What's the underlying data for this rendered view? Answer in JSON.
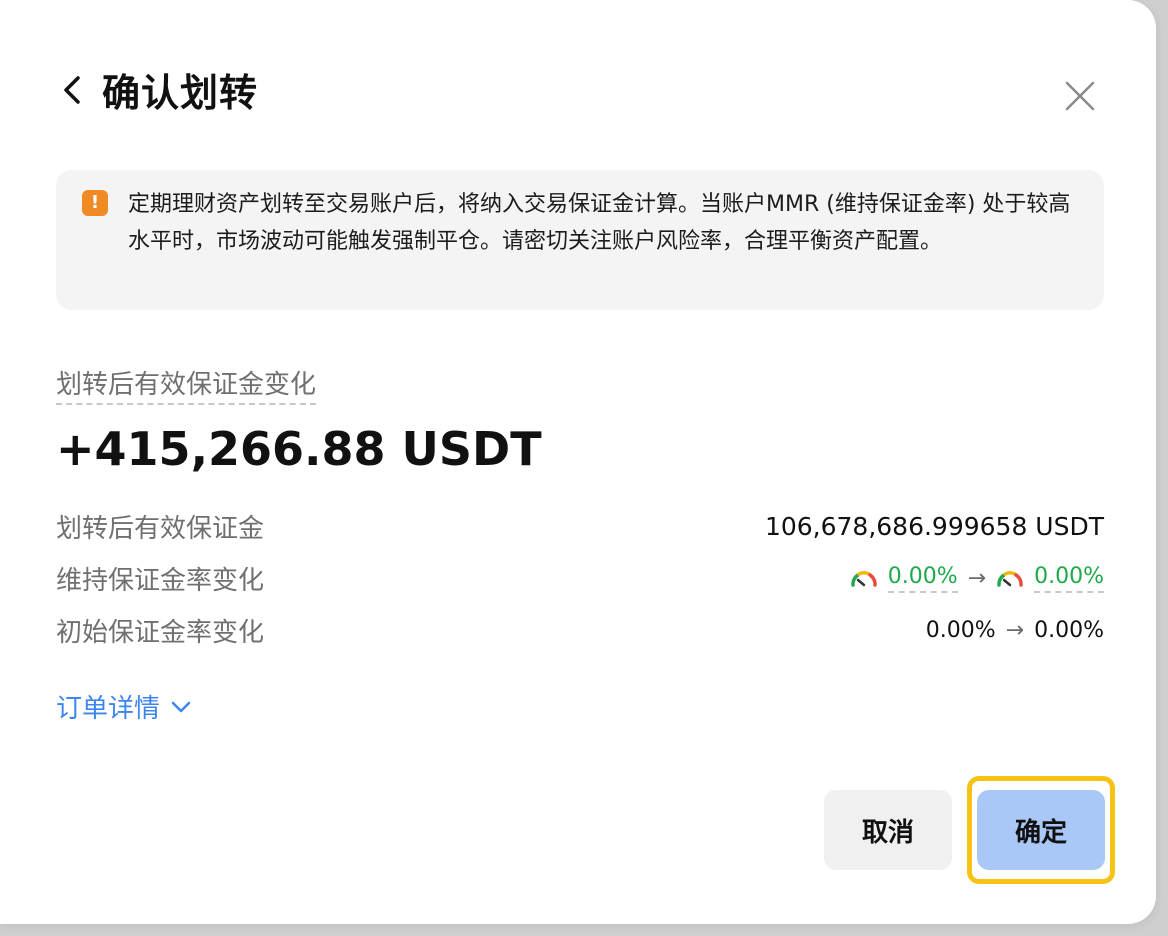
{
  "modal": {
    "title": "确认划转",
    "notice": "定期理财资产划转至交易账户后，将纳入交易保证金计算。当账户MMR (维持保证金率) 处于较高水平时，市场波动可能触发强制平仓。请密切关注账户风险率，合理平衡资产配置。",
    "section_label": "划转后有效保证金变化",
    "amount_change": "+415,266.88 USDT",
    "rows": {
      "effective_margin": {
        "label": "划转后有效保证金",
        "value": "106,678,686.999658 USDT"
      },
      "mmr_change": {
        "label": "维持保证金率变化",
        "from": "0.00%",
        "to": "0.00%"
      },
      "imr_change": {
        "label": "初始保证金率变化",
        "from": "0.00%",
        "to": "0.00%"
      }
    },
    "arrow": "→",
    "details_link": "订单详情",
    "buttons": {
      "cancel": "取消",
      "confirm": "确定"
    }
  },
  "colors": {
    "accent_blue": "#3e86ef",
    "positive_green": "#1fa94b",
    "warning_orange": "#f08a24",
    "highlight_yellow": "#f6c315",
    "confirm_bg": "#a9c8f7"
  }
}
